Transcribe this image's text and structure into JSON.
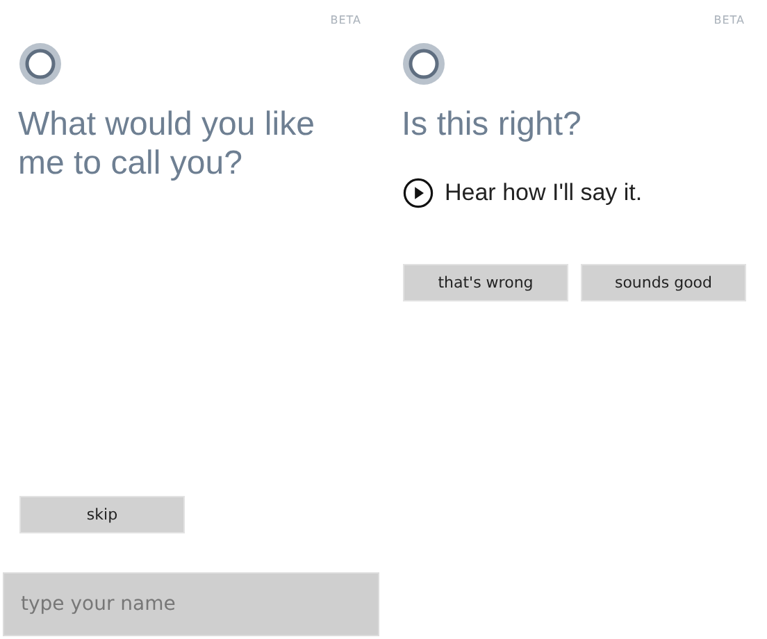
{
  "screens": [
    {
      "badge": "BETA",
      "heading": "What would you like me to call you?",
      "buttons": [
        {
          "label": "skip"
        }
      ],
      "input": {
        "placeholder": "type your name"
      }
    },
    {
      "badge": "BETA",
      "heading": "Is this right?",
      "audio_link": "Hear how I'll say it.",
      "buttons": [
        {
          "label": "that's wrong"
        },
        {
          "label": "sounds good"
        }
      ]
    }
  ]
}
